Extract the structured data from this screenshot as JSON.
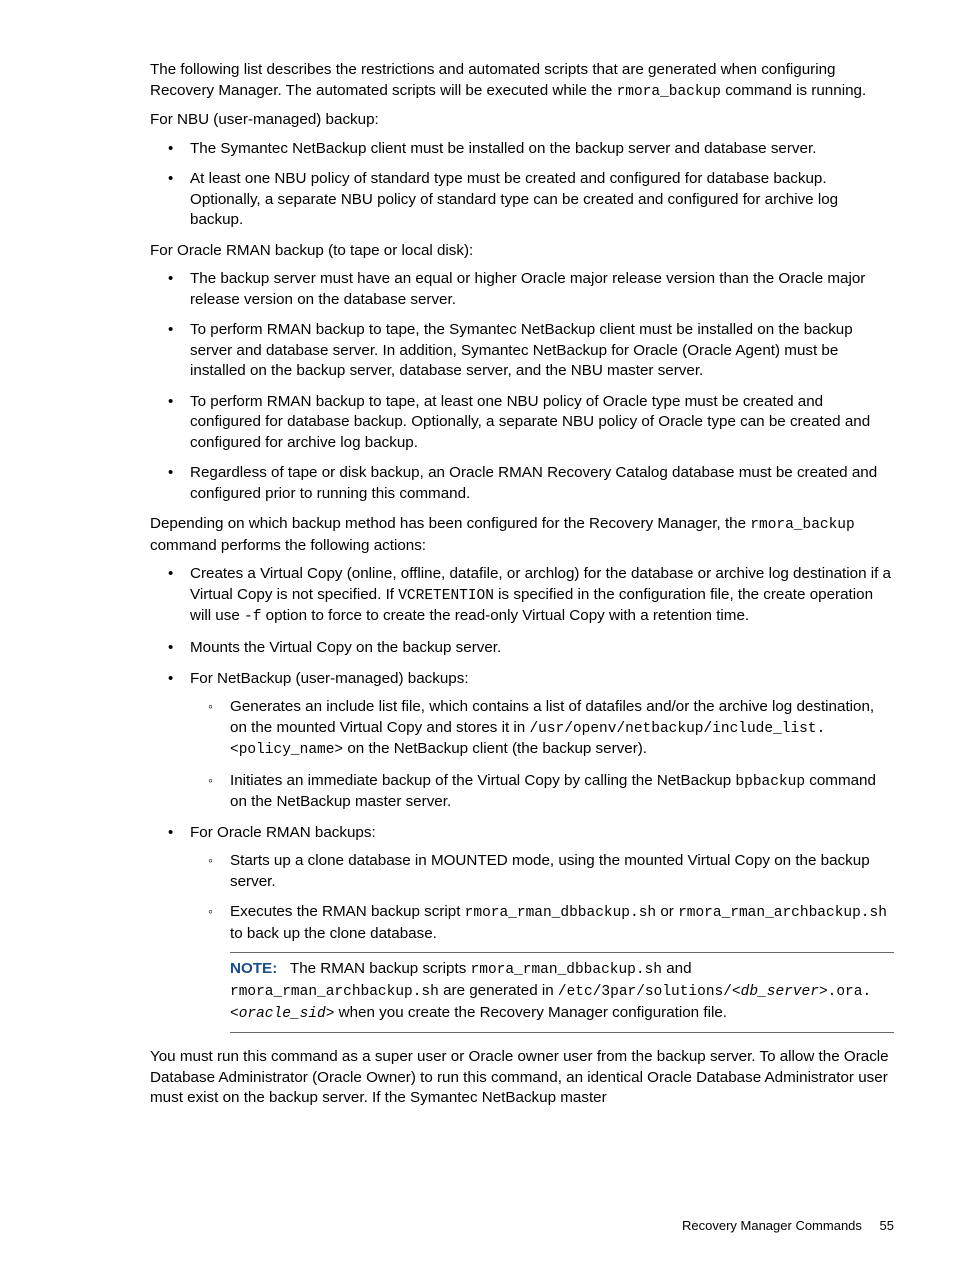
{
  "p_intro_1a": "The following list describes the restrictions and automated scripts that are generated when configuring Recovery Manager. The automated scripts will be executed while the ",
  "p_intro_1_code": "rmora_backup",
  "p_intro_1b": " command is running.",
  "p_nbu_heading": "For NBU (user-managed) backup:",
  "nbu_li_1": "The Symantec NetBackup client must be installed on the backup server and database server.",
  "nbu_li_2": "At least one NBU policy of standard type must be created and configured for database backup. Optionally, a separate NBU policy of standard type can be created and configured for archive log backup.",
  "p_rman_heading": "For Oracle RMAN backup (to tape or local disk):",
  "rman_li_1": "The backup server must have an equal or higher Oracle major release version than the Oracle major release version on the database server.",
  "rman_li_2": "To perform RMAN backup to tape, the Symantec NetBackup client must be installed on the backup server and database server. In addition, Symantec NetBackup for Oracle (Oracle Agent) must be installed on the backup server, database server, and the NBU master server.",
  "rman_li_3": "To perform RMAN backup to tape, at least one NBU policy of Oracle type must be created and configured for database backup. Optionally, a separate NBU policy of Oracle type can be created and configured for archive log backup.",
  "rman_li_4": "Regardless of tape or disk backup, an Oracle RMAN Recovery Catalog database must be created and configured prior to running this command.",
  "p_depending_a": "Depending on which backup method has been configured for the Recovery Manager, the ",
  "p_depending_code": "rmora_backup",
  "p_depending_b": " command performs the following actions:",
  "actions_li_1a": "Creates a Virtual Copy (online, offline, datafile, or archlog) for the database or archive log destination if a Virtual Copy is not specified. If ",
  "actions_li_1_code1": "VCRETENTION",
  "actions_li_1b": " is specified in the configuration file, the create operation will use ",
  "actions_li_1_code2": "-f",
  "actions_li_1c": " option to force to create the read-only Virtual Copy with a retention time.",
  "actions_li_2": "Mounts the Virtual Copy on the backup server.",
  "actions_li_3": "For NetBackup (user-managed) backups:",
  "actions_li_3_sub1a": "Generates an include list file, which contains a list of datafiles and/or the archive log destination, on the mounted Virtual Copy and stores it in ",
  "actions_li_3_sub1_code": "/usr/openv/netbackup/include_list.<policy_name>",
  "actions_li_3_sub1b": " on the NetBackup client (the backup server).",
  "actions_li_3_sub2a": "Initiates an immediate backup of the Virtual Copy by calling the NetBackup ",
  "actions_li_3_sub2_code": "bpbackup",
  "actions_li_3_sub2b": " command on the NetBackup master server.",
  "actions_li_4": "For Oracle RMAN backups:",
  "actions_li_4_sub1": "Starts up a clone database in MOUNTED mode, using the mounted Virtual Copy on the backup server.",
  "actions_li_4_sub2a": "Executes the RMAN backup script ",
  "actions_li_4_sub2_code1": "rmora_rman_dbbackup.sh",
  "actions_li_4_sub2b": " or ",
  "actions_li_4_sub2_code2": "rmora_rman_archbackup.sh",
  "actions_li_4_sub2c": " to back up the clone database.",
  "note_label": "NOTE:",
  "note_a": "The RMAN backup scripts ",
  "note_code1": "rmora_rman_dbbackup.sh",
  "note_b": " and ",
  "note_code2": "rmora_rman_archbackup.sh",
  "note_c": " are generated in ",
  "note_code3a": "/etc/3par/solutions/",
  "note_code3b": "<db_server>",
  "note_code3c": ".ora.",
  "note_code3d": "<oracle_sid>",
  "note_d": " when you create the Recovery Manager configuration file.",
  "p_final": "You must run this command as a super user or Oracle owner user from the backup server. To allow the Oracle Database Administrator (Oracle Owner) to run this command, an identical Oracle Database Administrator user must exist on the backup server. If the Symantec NetBackup master",
  "footer_title": "Recovery Manager Commands",
  "footer_page": "55"
}
